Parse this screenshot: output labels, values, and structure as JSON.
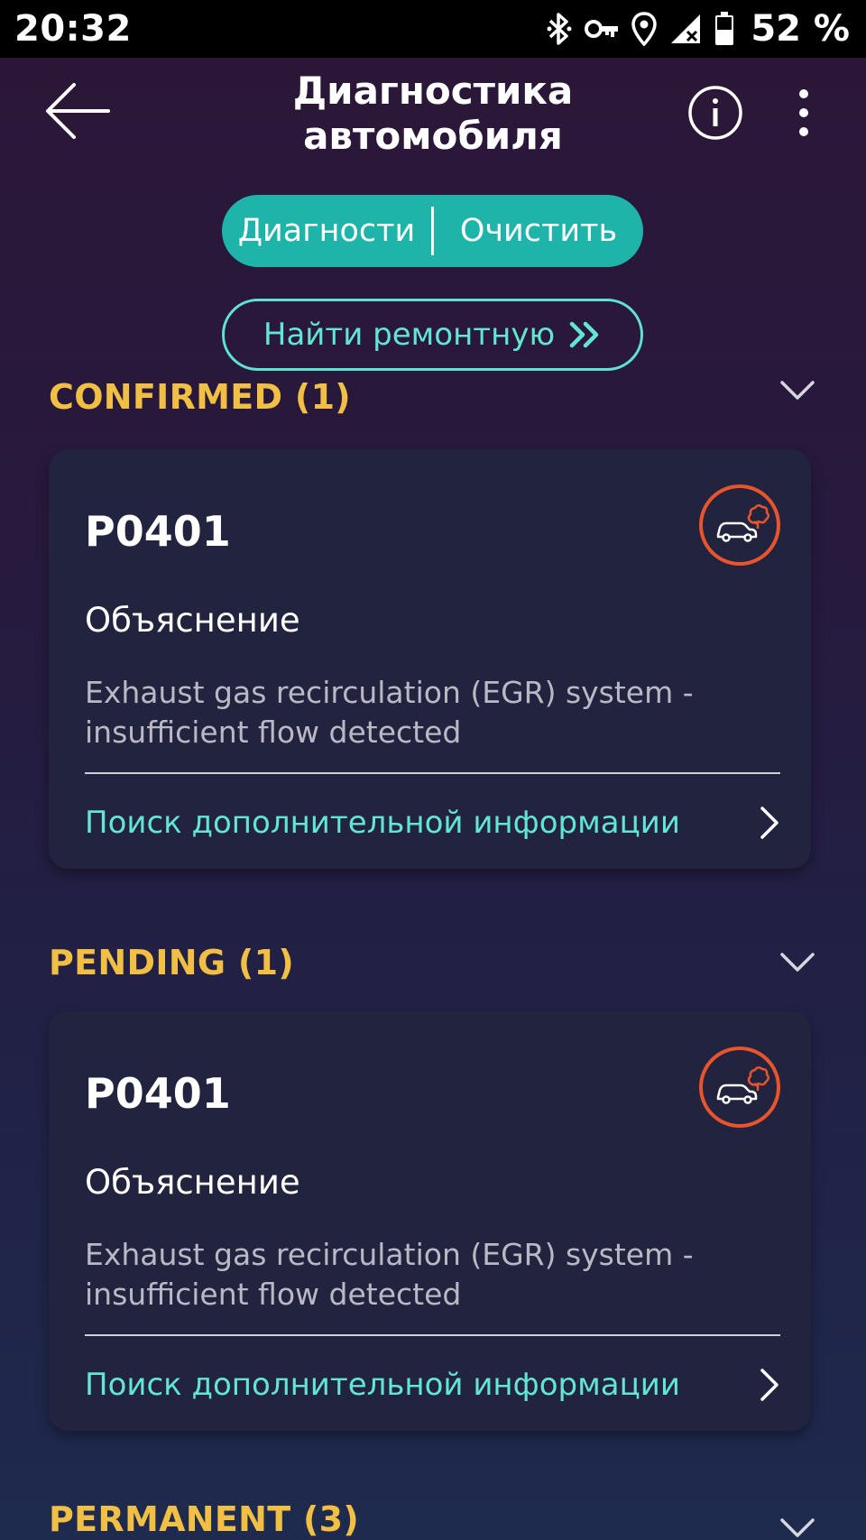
{
  "status_bar": {
    "time": "20:32",
    "battery_percent": "52 %",
    "icons": [
      "bluetooth-icon",
      "vpn-key-icon",
      "location-icon",
      "signal-icon",
      "battery-icon"
    ]
  },
  "header": {
    "title": "Диагностика автомобиля",
    "back_icon": "arrow-left-icon",
    "info_icon": "info-icon",
    "menu_icon": "more-vert-icon"
  },
  "segment": {
    "left_label": "Диагности",
    "right_label": "Очистить"
  },
  "find_repair": {
    "label": "Найти ремонтную",
    "icon": "double-chevron-right-icon"
  },
  "sections": [
    {
      "title": "CONFIRMED (1)",
      "expanded": true,
      "cards": [
        {
          "code": "P0401",
          "explanation_label": "Объяснение",
          "description": "Exhaust gas recirculation (EGR) system -insufficient flow detected",
          "more_info_label": "Поиск дополнительной информации",
          "icon": "car-emission-icon"
        }
      ]
    },
    {
      "title": "PENDING (1)",
      "expanded": true,
      "cards": [
        {
          "code": "P0401",
          "explanation_label": "Объяснение",
          "description": "Exhaust gas recirculation (EGR) system -insufficient flow detected",
          "more_info_label": "Поиск дополнительной информации",
          "icon": "car-emission-icon"
        }
      ]
    },
    {
      "title": "PERMANENT (3)",
      "expanded": false,
      "cards": []
    }
  ],
  "colors": {
    "accent_teal": "#1fb4aa",
    "link_teal": "#62e6d2",
    "section_yellow": "#f0bf43",
    "warning_orange": "#e8542b",
    "card_bg": "#22233f"
  }
}
